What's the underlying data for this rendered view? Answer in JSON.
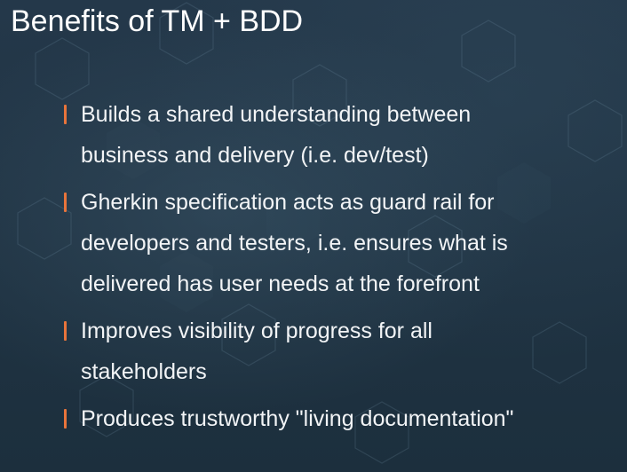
{
  "slide": {
    "title": "Benefits of TM + BDD",
    "accent_color": "#e8743b",
    "text_color": "#f2f4f6",
    "background_color": "#1f3240",
    "bullets": [
      {
        "lines": [
          "Builds a shared understanding between",
          "business and delivery (i.e. dev/test)"
        ]
      },
      {
        "lines": [
          "Gherkin specification acts as guard rail for",
          "developers and testers, i.e. ensures what is",
          "delivered has user needs at the forefront"
        ]
      },
      {
        "lines": [
          "Improves visibility of progress for all",
          "stakeholders"
        ]
      },
      {
        "lines": [
          "Produces trustworthy \"living documentation\""
        ]
      }
    ]
  }
}
